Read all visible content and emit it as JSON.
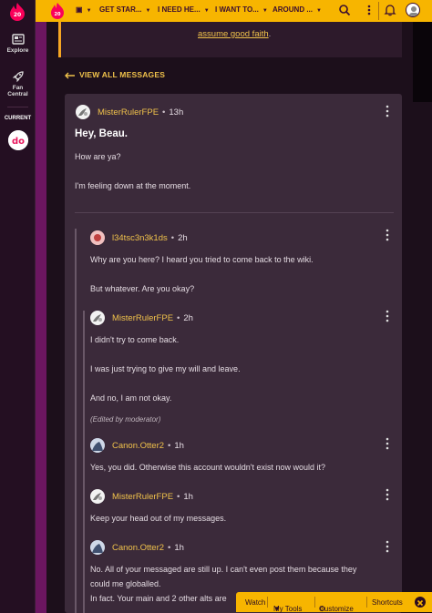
{
  "rail": {
    "items": [
      {
        "label": "Explore",
        "icon": "explore-icon"
      },
      {
        "label": "Fan\nCentral",
        "icon": "rocket-icon"
      }
    ],
    "current_label": "CURRENT"
  },
  "topbar": {
    "nav": [
      "GET STAR...",
      "I NEED HE...",
      "I WANT TO...",
      "AROUND ..."
    ]
  },
  "notice": {
    "text_tail": "assume good faith",
    "period": "."
  },
  "view_all_label": "VIEW ALL MESSAGES",
  "thread": {
    "original": {
      "author": "MisterRulerFPE",
      "time": "13h",
      "title": "Hey, Beau.",
      "lines": [
        "How are ya?",
        "I'm feeling down at the moment."
      ]
    },
    "replies": [
      {
        "author": "l34tsc3n3k1ds",
        "time": "2h",
        "lines": [
          "Why are you here? I heard you tried to come back to the wiki.",
          "But whatever. Are you okay?"
        ]
      },
      {
        "author": "MisterRulerFPE",
        "time": "2h",
        "lines": [
          "I didn't try to come back.",
          "I was just trying to give my will and leave.",
          "And no, I am not okay."
        ],
        "edited": "(Edited by moderator)"
      },
      {
        "author": "Canon.Otter2",
        "time": "1h",
        "lines": [
          "Yes, you did. Otherwise this account wouldn't exist now would it?"
        ]
      },
      {
        "author": "MisterRulerFPE",
        "time": "1h",
        "lines": [
          "Keep your head out of my messages."
        ]
      },
      {
        "author": "Canon.Otter2",
        "time": "1h",
        "lines": [
          "No. All of your messaged are still up. I can't even post them because they",
          "could me globalled.",
          "In fact. Your main and 2 other alts are"
        ]
      }
    ]
  },
  "toolbar": {
    "watch": "Watch",
    "my_tools": "My Tools",
    "customize": "Customize",
    "shortcuts": "Shortcuts"
  },
  "colors": {
    "accent": "#f7b500",
    "link": "#f0c24b",
    "thread_bg": "#3b2a3a",
    "page_bg": "#1c0f1b"
  }
}
